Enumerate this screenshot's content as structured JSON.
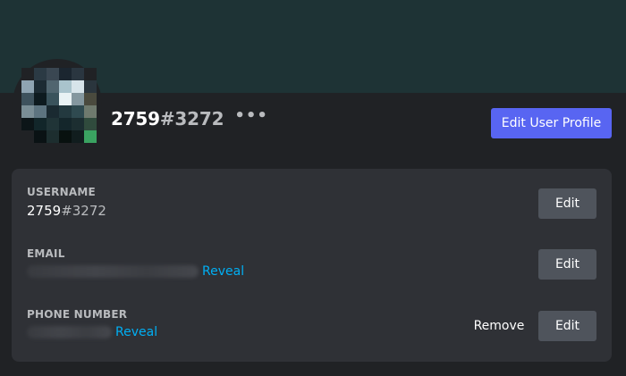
{
  "profile": {
    "username": "2759",
    "discriminator": "#3272",
    "more_icon": "more-dots-icon",
    "edit_profile_label": "Edit User Profile",
    "banner_color": "#1e3335",
    "accent_color": "#5865f2"
  },
  "account": {
    "username": {
      "label": "USERNAME",
      "name": "2759",
      "discriminator": "#3272",
      "edit_label": "Edit"
    },
    "email": {
      "label": "EMAIL",
      "reveal_label": "Reveal",
      "edit_label": "Edit"
    },
    "phone": {
      "label": "PHONE NUMBER",
      "reveal_label": "Reveal",
      "remove_label": "Remove",
      "edit_label": "Edit"
    }
  }
}
